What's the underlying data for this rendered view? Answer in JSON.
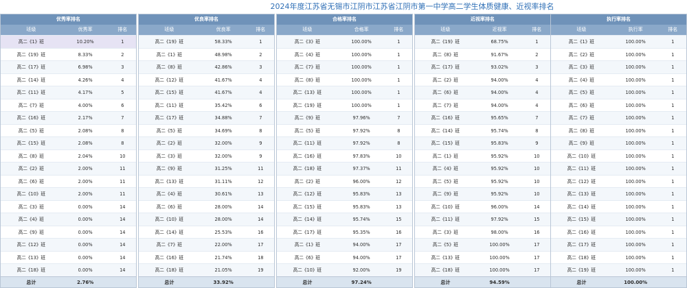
{
  "title": "2024年度江苏省无锡市江阴市江苏省江阴市第一中学高二学生体质健康、近视率排名",
  "tables": [
    {
      "header": "优秀率排名",
      "col_class": "班级",
      "col_rate": "优秀率",
      "col_rank": "排名",
      "rows": [
        {
          "class": "高二《1》班",
          "rate": "10.20%",
          "rank": "1"
        },
        {
          "class": "高二《19》班",
          "rate": "8.33%",
          "rank": "2"
        },
        {
          "class": "高二《17》班",
          "rate": "6.98%",
          "rank": "3"
        },
        {
          "class": "高二《14》班",
          "rate": "4.26%",
          "rank": "4"
        },
        {
          "class": "高二《11》班",
          "rate": "4.17%",
          "rank": "5"
        },
        {
          "class": "高二《7》班",
          "rate": "4.00%",
          "rank": "6"
        },
        {
          "class": "高二《16》班",
          "rate": "2.17%",
          "rank": "7"
        },
        {
          "class": "高二《5》班",
          "rate": "2.08%",
          "rank": "8"
        },
        {
          "class": "高二《15》班",
          "rate": "2.08%",
          "rank": "8"
        },
        {
          "class": "高二《8》班",
          "rate": "2.04%",
          "rank": "10"
        },
        {
          "class": "高二《2》班",
          "rate": "2.00%",
          "rank": "11"
        },
        {
          "class": "高二《6》班",
          "rate": "2.00%",
          "rank": "11"
        },
        {
          "class": "高二《10》班",
          "rate": "2.00%",
          "rank": "11"
        },
        {
          "class": "高二《3》班",
          "rate": "0.00%",
          "rank": "14"
        },
        {
          "class": "高二《4》班",
          "rate": "0.00%",
          "rank": "14"
        },
        {
          "class": "高二《9》班",
          "rate": "0.00%",
          "rank": "14"
        },
        {
          "class": "高二《12》班",
          "rate": "0.00%",
          "rank": "14"
        },
        {
          "class": "高二《13》班",
          "rate": "0.00%",
          "rank": "14"
        },
        {
          "class": "高二《18》班",
          "rate": "0.00%",
          "rank": "14"
        }
      ],
      "total_label": "总计",
      "total_value": "2.76%"
    },
    {
      "header": "优良率排名",
      "col_class": "班级",
      "col_rate": "优良率",
      "col_rank": "排名",
      "rows": [
        {
          "class": "高二《19》班",
          "rate": "58.33%",
          "rank": "1"
        },
        {
          "class": "高二《1》班",
          "rate": "48.98%",
          "rank": "2"
        },
        {
          "class": "高二《8》班",
          "rate": "42.86%",
          "rank": "3"
        },
        {
          "class": "高二《12》班",
          "rate": "41.67%",
          "rank": "4"
        },
        {
          "class": "高二《15》班",
          "rate": "41.67%",
          "rank": "4"
        },
        {
          "class": "高二《11》班",
          "rate": "35.42%",
          "rank": "6"
        },
        {
          "class": "高二《17》班",
          "rate": "34.88%",
          "rank": "7"
        },
        {
          "class": "高二《5》班",
          "rate": "34.69%",
          "rank": "8"
        },
        {
          "class": "高二《2》班",
          "rate": "32.00%",
          "rank": "9"
        },
        {
          "class": "高二《3》班",
          "rate": "32.00%",
          "rank": "9"
        },
        {
          "class": "高二《9》班",
          "rate": "31.25%",
          "rank": "11"
        },
        {
          "class": "高二《13》班",
          "rate": "31.11%",
          "rank": "12"
        },
        {
          "class": "高二《4》班",
          "rate": "30.61%",
          "rank": "13"
        },
        {
          "class": "高二《6》班",
          "rate": "28.00%",
          "rank": "14"
        },
        {
          "class": "高二《10》班",
          "rate": "28.00%",
          "rank": "14"
        },
        {
          "class": "高二《14》班",
          "rate": "25.53%",
          "rank": "16"
        },
        {
          "class": "高二《7》班",
          "rate": "22.00%",
          "rank": "17"
        },
        {
          "class": "高二《16》班",
          "rate": "21.74%",
          "rank": "18"
        },
        {
          "class": "高二《18》班",
          "rate": "21.05%",
          "rank": "19"
        }
      ],
      "total_label": "总计",
      "total_value": "33.92%"
    },
    {
      "header": "合格率排名",
      "col_class": "班级",
      "col_rate": "合格率",
      "col_rank": "排名",
      "rows": [
        {
          "class": "高二《3》班",
          "rate": "100.00%",
          "rank": "1"
        },
        {
          "class": "高二《4》班",
          "rate": "100.00%",
          "rank": "1"
        },
        {
          "class": "高二《7》班",
          "rate": "100.00%",
          "rank": "1"
        },
        {
          "class": "高二《8》班",
          "rate": "100.00%",
          "rank": "1"
        },
        {
          "class": "高二《13》班",
          "rate": "100.00%",
          "rank": "1"
        },
        {
          "class": "高二《19》班",
          "rate": "100.00%",
          "rank": "1"
        },
        {
          "class": "高二《9》班",
          "rate": "97.96%",
          "rank": "7"
        },
        {
          "class": "高二《5》班",
          "rate": "97.92%",
          "rank": "8"
        },
        {
          "class": "高二《11》班",
          "rate": "97.92%",
          "rank": "8"
        },
        {
          "class": "高二《16》班",
          "rate": "97.83%",
          "rank": "10"
        },
        {
          "class": "高二《18》班",
          "rate": "97.37%",
          "rank": "11"
        },
        {
          "class": "高二《2》班",
          "rate": "96.00%",
          "rank": "12"
        },
        {
          "class": "高二《12》班",
          "rate": "95.83%",
          "rank": "13"
        },
        {
          "class": "高二《15》班",
          "rate": "95.83%",
          "rank": "13"
        },
        {
          "class": "高二《14》班",
          "rate": "95.74%",
          "rank": "15"
        },
        {
          "class": "高二《17》班",
          "rate": "95.35%",
          "rank": "16"
        },
        {
          "class": "高二《1》班",
          "rate": "94.00%",
          "rank": "17"
        },
        {
          "class": "高二《6》班",
          "rate": "94.00%",
          "rank": "17"
        },
        {
          "class": "高二《10》班",
          "rate": "92.00%",
          "rank": "19"
        }
      ],
      "total_label": "总计",
      "total_value": "97.24%"
    },
    {
      "header": "近视率排名",
      "col_class": "班级",
      "col_rate": "近视率",
      "col_rank": "排名",
      "rows": [
        {
          "class": "高二《19》班",
          "rate": "68.75%",
          "rank": "1"
        },
        {
          "class": "高二《8》班",
          "rate": "91.67%",
          "rank": "2"
        },
        {
          "class": "高二《17》班",
          "rate": "93.02%",
          "rank": "3"
        },
        {
          "class": "高二《2》班",
          "rate": "94.00%",
          "rank": "4"
        },
        {
          "class": "高二《6》班",
          "rate": "94.00%",
          "rank": "4"
        },
        {
          "class": "高二《7》班",
          "rate": "94.00%",
          "rank": "4"
        },
        {
          "class": "高二《16》班",
          "rate": "95.65%",
          "rank": "7"
        },
        {
          "class": "高二《14》班",
          "rate": "95.74%",
          "rank": "8"
        },
        {
          "class": "高二《15》班",
          "rate": "95.83%",
          "rank": "9"
        },
        {
          "class": "高二《1》班",
          "rate": "95.92%",
          "rank": "10"
        },
        {
          "class": "高二《4》班",
          "rate": "95.92%",
          "rank": "10"
        },
        {
          "class": "高二《5》班",
          "rate": "95.92%",
          "rank": "10"
        },
        {
          "class": "高二《9》班",
          "rate": "95.92%",
          "rank": "10"
        },
        {
          "class": "高二《10》班",
          "rate": "96.00%",
          "rank": "14"
        },
        {
          "class": "高二《11》班",
          "rate": "97.92%",
          "rank": "15"
        },
        {
          "class": "高二《3》班",
          "rate": "98.00%",
          "rank": "16"
        },
        {
          "class": "高二《5》班",
          "rate": "100.00%",
          "rank": "17"
        },
        {
          "class": "高二《13》班",
          "rate": "100.00%",
          "rank": "17"
        },
        {
          "class": "高二《18》班",
          "rate": "100.00%",
          "rank": "17"
        }
      ],
      "total_label": "总计",
      "total_value": "94.59%"
    },
    {
      "header": "执行率排名",
      "col_class": "班级",
      "col_rate": "执行率",
      "col_rank": "排名",
      "rows": [
        {
          "class": "高二《1》班",
          "rate": "100.00%",
          "rank": "1"
        },
        {
          "class": "高二《2》班",
          "rate": "100.00%",
          "rank": "1"
        },
        {
          "class": "高二《3》班",
          "rate": "100.00%",
          "rank": "1"
        },
        {
          "class": "高二《4》班",
          "rate": "100.00%",
          "rank": "1"
        },
        {
          "class": "高二《5》班",
          "rate": "100.00%",
          "rank": "1"
        },
        {
          "class": "高二《6》班",
          "rate": "100.00%",
          "rank": "1"
        },
        {
          "class": "高二《7》班",
          "rate": "100.00%",
          "rank": "1"
        },
        {
          "class": "高二《8》班",
          "rate": "100.00%",
          "rank": "1"
        },
        {
          "class": "高二《9》班",
          "rate": "100.00%",
          "rank": "1"
        },
        {
          "class": "高二《10》班",
          "rate": "100.00%",
          "rank": "1"
        },
        {
          "class": "高二《11》班",
          "rate": "100.00%",
          "rank": "1"
        },
        {
          "class": "高二《12》班",
          "rate": "100.00%",
          "rank": "1"
        },
        {
          "class": "高二《13》班",
          "rate": "100.00%",
          "rank": "1"
        },
        {
          "class": "高二《14》班",
          "rate": "100.00%",
          "rank": "1"
        },
        {
          "class": "高二《15》班",
          "rate": "100.00%",
          "rank": "1"
        },
        {
          "class": "高二《16》班",
          "rate": "100.00%",
          "rank": "1"
        },
        {
          "class": "高二《17》班",
          "rate": "100.00%",
          "rank": "1"
        },
        {
          "class": "高二《18》班",
          "rate": "100.00%",
          "rank": "1"
        },
        {
          "class": "高二《19》班",
          "rate": "100.00%",
          "rank": "1"
        }
      ],
      "total_label": "总计",
      "total_value": "100.00%"
    }
  ]
}
